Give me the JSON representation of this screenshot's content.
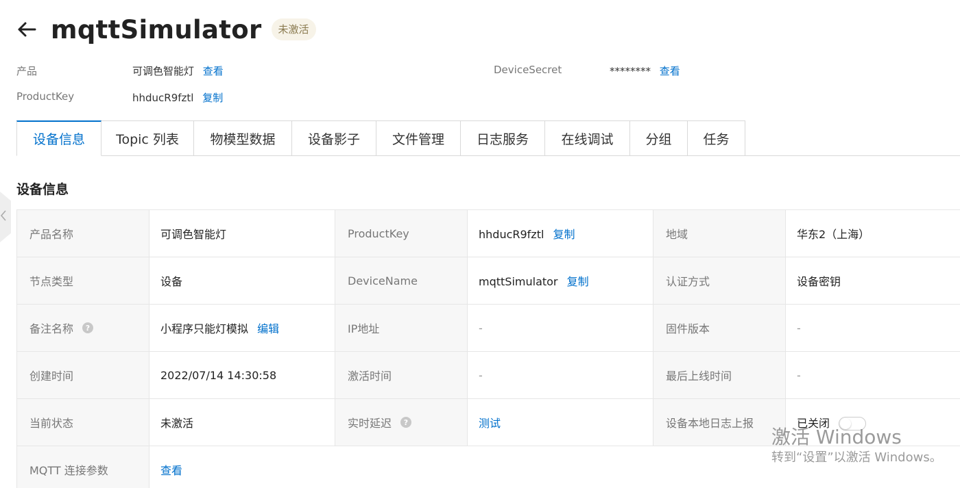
{
  "header": {
    "title": "mqttSimulator",
    "status": "未激活"
  },
  "meta": {
    "product_label": "产品",
    "product_value": "可调色智能灯",
    "product_view": "查看",
    "productkey_label": "ProductKey",
    "productkey_value": "hhducR9fztl",
    "productkey_copy": "复制",
    "secret_label": "DeviceSecret",
    "secret_value": "********",
    "secret_view": "查看"
  },
  "tabs": [
    {
      "label": "设备信息",
      "active": true
    },
    {
      "label": "Topic 列表"
    },
    {
      "label": "物模型数据"
    },
    {
      "label": "设备影子"
    },
    {
      "label": "文件管理"
    },
    {
      "label": "日志服务"
    },
    {
      "label": "在线调试"
    },
    {
      "label": "分组"
    },
    {
      "label": "任务"
    }
  ],
  "section_title": "设备信息",
  "info": {
    "r1": {
      "l1": "产品名称",
      "v1": "可调色智能灯",
      "l2": "ProductKey",
      "v2": "hhducR9fztl",
      "v2_link": "复制",
      "l3": "地域",
      "v3": "华东2（上海）"
    },
    "r2": {
      "l1": "节点类型",
      "v1": "设备",
      "l2": "DeviceName",
      "v2": "mqttSimulator",
      "v2_link": "复制",
      "l3": "认证方式",
      "v3": "设备密钥"
    },
    "r3": {
      "l1": "备注名称",
      "v1": "小程序只能灯模拟",
      "v1_link": "编辑",
      "l2": "IP地址",
      "v2": "-",
      "l3": "固件版本",
      "v3": "-"
    },
    "r4": {
      "l1": "创建时间",
      "v1": "2022/07/14 14:30:58",
      "l2": "激活时间",
      "v2": "-",
      "l3": "最后上线时间",
      "v3": "-"
    },
    "r5": {
      "l1": "当前状态",
      "v1": "未激活",
      "l2": "实时延迟",
      "v2_link": "测试",
      "l3": "设备本地日志上报",
      "v3": "已关闭"
    },
    "r6": {
      "l1": "MQTT 连接参数",
      "v1_link": "查看"
    }
  },
  "watermark": {
    "title": "激活 Windows",
    "subtitle": "转到“设置”以激活 Windows。"
  },
  "colors": {
    "link": "#0070cc",
    "label_bg": "#f7f7f7",
    "border": "#e6e6e6",
    "badge_bg": "#f7f3e8"
  }
}
